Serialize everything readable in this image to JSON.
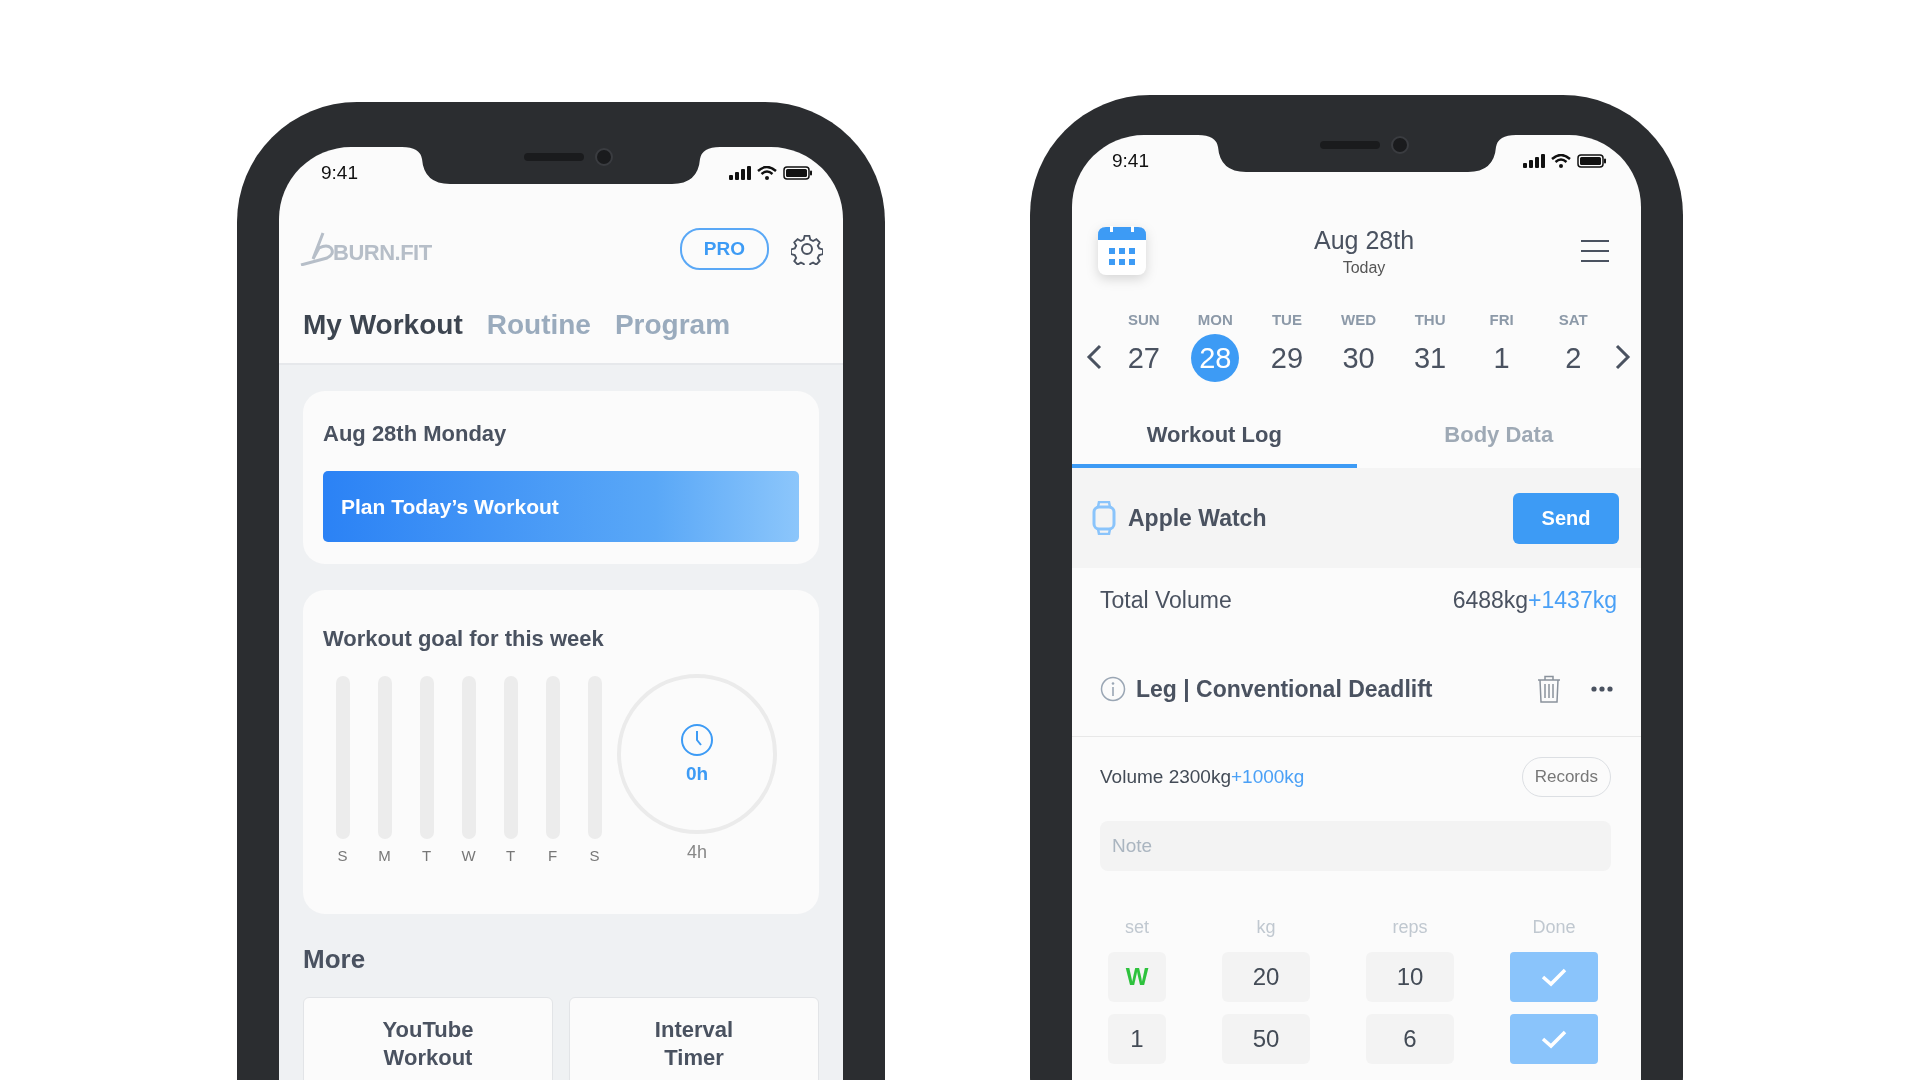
{
  "home_screen": {
    "status_time": "9:41",
    "logo": "BURN.FIT",
    "pro_badge": "PRO",
    "tabs": [
      {
        "label": "My Workout",
        "selected": true
      },
      {
        "label": "Routine",
        "selected": false
      },
      {
        "label": "Program",
        "selected": false
      }
    ],
    "today_card": {
      "date": "Aug 28th Monday",
      "button": "Plan Today’s Workout"
    },
    "goal_card": {
      "title": "Workout goal for this week",
      "days": [
        {
          "label": "S"
        },
        {
          "label": "M"
        },
        {
          "label": "T"
        },
        {
          "label": "W"
        },
        {
          "label": "T"
        },
        {
          "label": "F"
        },
        {
          "label": "S"
        }
      ],
      "ring": {
        "value": "0h",
        "goal": "4h"
      }
    },
    "more": {
      "title": "More",
      "tiles": [
        "YouTube Workout",
        "Interval Timer"
      ]
    }
  },
  "log_screen": {
    "status_time": "9:41",
    "date": "Aug 28th",
    "subtitle": "Today",
    "week": [
      {
        "weekday": "SUN",
        "day": "27",
        "selected": false
      },
      {
        "weekday": "MON",
        "day": "28",
        "selected": true
      },
      {
        "weekday": "TUE",
        "day": "29",
        "selected": false
      },
      {
        "weekday": "WED",
        "day": "30",
        "selected": false
      },
      {
        "weekday": "THU",
        "day": "31",
        "selected": false
      },
      {
        "weekday": "FRI",
        "day": "1",
        "selected": false
      },
      {
        "weekday": "SAT",
        "day": "2",
        "selected": false
      }
    ],
    "tabs": [
      {
        "label": "Workout Log",
        "selected": true
      },
      {
        "label": "Body Data",
        "selected": false
      }
    ],
    "watch": {
      "label": "Apple Watch",
      "button": "Send"
    },
    "total": {
      "label": "Total Volume",
      "value": "6488kg",
      "delta": "+1437kg"
    },
    "exercise": {
      "title": "Leg | Conventional Deadlift",
      "volume": "Volume 2300kg",
      "volume_delta": "+1000kg",
      "records_button": "Records",
      "note_placeholder": "Note",
      "columns": [
        "set",
        "kg",
        "reps",
        "Done"
      ],
      "sets": [
        {
          "set": "W",
          "kind": "warmup",
          "kg": "20",
          "reps": "10",
          "done": true
        },
        {
          "set": "1",
          "kind": "normal",
          "kg": "50",
          "reps": "6",
          "done": true
        }
      ]
    }
  }
}
